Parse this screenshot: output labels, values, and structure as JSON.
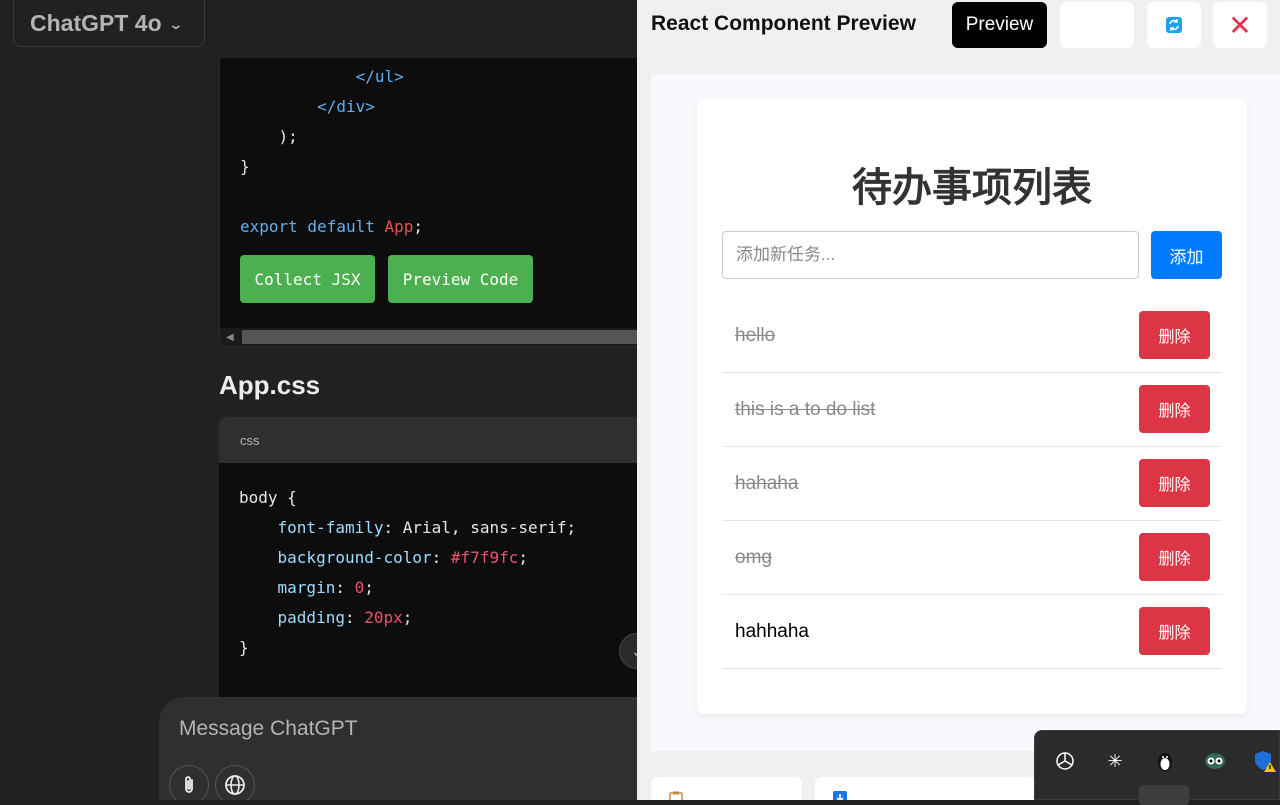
{
  "chat": {
    "model_label": "ChatGPT 4o",
    "code_block_1": {
      "lines": [
        {
          "indent": "            ",
          "text": "</ul>",
          "cls": "tag"
        },
        {
          "indent": "        ",
          "text": "</div>",
          "cls": "tag"
        },
        {
          "indent": "    ",
          "text": ");",
          "cls": ""
        },
        {
          "indent": "",
          "text": "}",
          "cls": ""
        },
        {
          "indent": "",
          "text": "",
          "cls": ""
        },
        {
          "indent": "",
          "text": "export default App;",
          "cls": "export"
        }
      ],
      "collect_label": "Collect JSX",
      "preview_label": "Preview Code"
    },
    "file_heading": "App.css",
    "code_block_2": {
      "language": "css",
      "selector": "body {",
      "declarations": [
        {
          "prop": "font-family",
          "value": "Arial, sans-serif",
          "val_cls": "plain"
        },
        {
          "prop": "background-color",
          "value": "#f7f9fc",
          "val_cls": "val"
        },
        {
          "prop": "margin",
          "value": "0",
          "val_cls": "val"
        },
        {
          "prop": "padding",
          "value": "20px",
          "val_cls": "val"
        }
      ],
      "closing": "}"
    },
    "composer_placeholder": "Message ChatGPT"
  },
  "preview_panel": {
    "title": "React Component Preview",
    "preview_button": "Preview",
    "refresh_icon": "refresh-icon",
    "close_icon": "close-icon",
    "app": {
      "heading": "待办事项列表",
      "input_placeholder": "添加新任务...",
      "add_button": "添加",
      "todos": [
        {
          "text": "hello",
          "done": true,
          "delete_label": "删除"
        },
        {
          "text": "this is a to do list",
          "done": true,
          "delete_label": "删除"
        },
        {
          "text": "hahaha",
          "done": true,
          "delete_label": "删除"
        },
        {
          "text": "omg",
          "done": true,
          "delete_label": "删除"
        },
        {
          "text": "hahhaha",
          "done": false,
          "delete_label": "删除"
        }
      ]
    }
  },
  "system_tray": {
    "icons": [
      "openai-icon",
      "sparkle-icon",
      "penguin-icon",
      "owl-icon",
      "shield-warning-icon"
    ]
  },
  "colors": {
    "green_button": "#4caf50",
    "add_button": "#007bff",
    "delete_button": "#dc3545",
    "close_icon": "#e5334b"
  }
}
